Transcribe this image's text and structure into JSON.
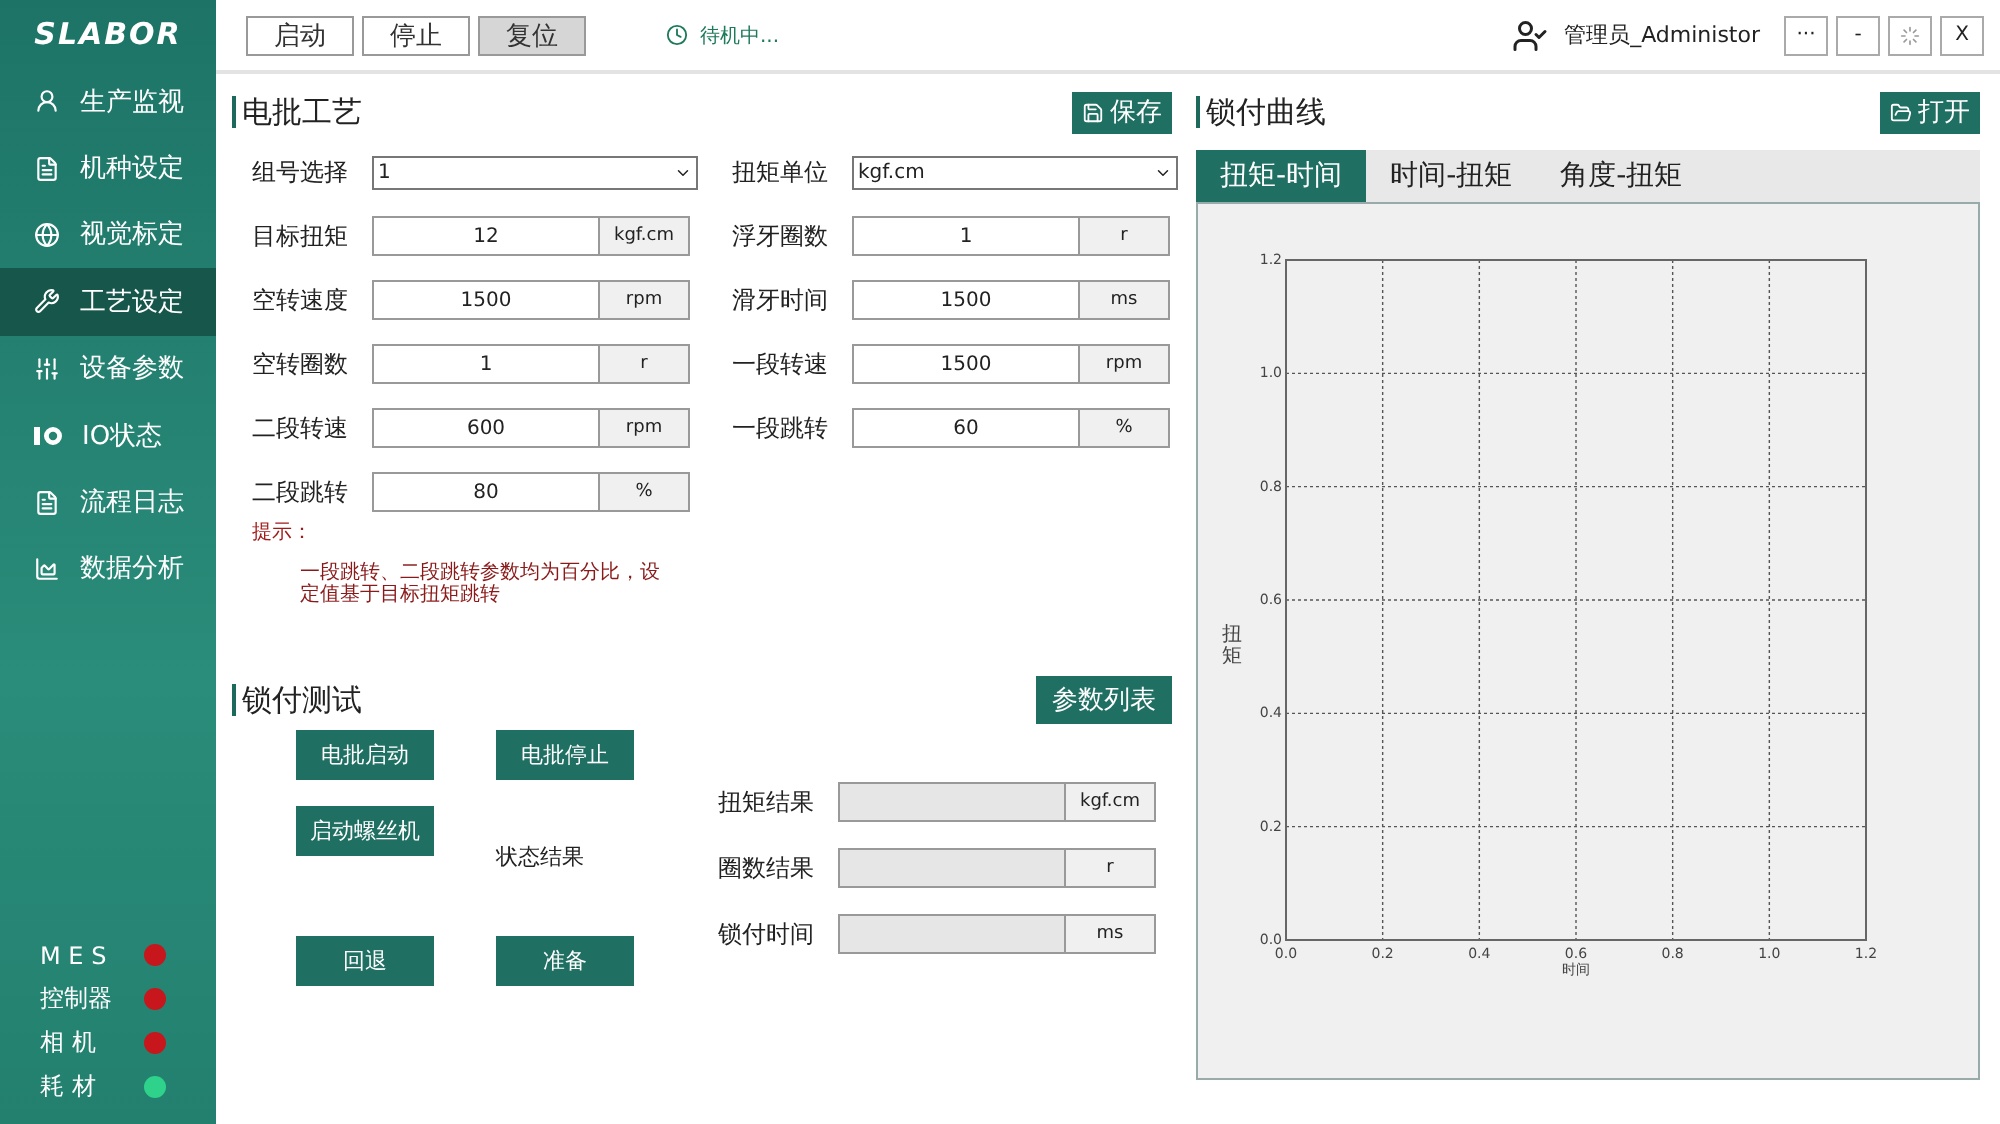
{
  "logo": "SLABOR",
  "sidebar": {
    "items": [
      {
        "label": "生产监视",
        "selected": false
      },
      {
        "label": "机种设定",
        "selected": false
      },
      {
        "label": "视觉标定",
        "selected": false
      },
      {
        "label": "工艺设定",
        "selected": true
      },
      {
        "label": "设备参数",
        "selected": false
      },
      {
        "label": "IO状态",
        "selected": false
      },
      {
        "label": "流程日志",
        "selected": false
      },
      {
        "label": "数据分析",
        "selected": false
      }
    ],
    "status": [
      {
        "label": "M E S",
        "color": "#c8161d"
      },
      {
        "label": "控制器",
        "color": "#c8161d"
      },
      {
        "label": "相 机",
        "color": "#c8161d"
      },
      {
        "label": "耗 材",
        "color": "#2ed28a"
      }
    ]
  },
  "toolbar": {
    "buttons": [
      {
        "label": "启动",
        "selected": false
      },
      {
        "label": "停止",
        "selected": false
      },
      {
        "label": "复位",
        "selected": true
      }
    ],
    "status": "待机中...",
    "user": "管理员_Administor",
    "window_buttons": [
      "···",
      "-",
      "X"
    ]
  },
  "process": {
    "title": "电批工艺",
    "save": "保存",
    "rows": [
      [
        {
          "label": "组号选择",
          "kind": "select",
          "value": "1"
        },
        {
          "label": "扭矩单位",
          "kind": "select",
          "value": "kgf.cm"
        }
      ],
      [
        {
          "label": "目标扭矩",
          "kind": "input",
          "value": "12",
          "unit": "kgf.cm"
        },
        {
          "label": "浮牙圈数",
          "kind": "input",
          "value": "1",
          "unit": "r"
        }
      ],
      [
        {
          "label": "空转速度",
          "kind": "input",
          "value": "1500",
          "unit": "rpm"
        },
        {
          "label": "滑牙时间",
          "kind": "input",
          "value": "1500",
          "unit": "ms"
        }
      ],
      [
        {
          "label": "空转圈数",
          "kind": "input",
          "value": "1",
          "unit": "r"
        },
        {
          "label": "一段转速",
          "kind": "input",
          "value": "1500",
          "unit": "rpm"
        }
      ],
      [
        {
          "label": "二段转速",
          "kind": "input",
          "value": "600",
          "unit": "rpm"
        },
        {
          "label": "一段跳转",
          "kind": "input",
          "value": "60",
          "unit": "%"
        }
      ],
      [
        {
          "label": "二段跳转",
          "kind": "input",
          "value": "80",
          "unit": "%"
        }
      ]
    ],
    "hint_title": "提示：",
    "hint": "一段跳转、二段跳转参数均为百分比，设定值基于目标扭矩跳转"
  },
  "test": {
    "title": "锁付测试",
    "param_list": "参数列表",
    "buttons": [
      "电批启动",
      "电批停止",
      "启动螺丝机",
      "回退",
      "准备"
    ],
    "state_label": "状态结果",
    "results": [
      {
        "label": "扭矩结果",
        "unit": "kgf.cm"
      },
      {
        "label": "圈数结果",
        "unit": "r"
      },
      {
        "label": "锁付时间",
        "unit": "ms"
      }
    ]
  },
  "curve": {
    "title": "锁付曲线",
    "open": "打开",
    "tabs": [
      {
        "label": "扭矩-时间",
        "selected": true
      },
      {
        "label": "时间-扭矩",
        "selected": false
      },
      {
        "label": "角度-扭矩",
        "selected": false
      }
    ],
    "chart_data": {
      "type": "line",
      "grid": true,
      "xlabel": "时间",
      "ylabel": "扭矩",
      "xlim": [
        0,
        1.2
      ],
      "ylim": [
        0,
        1.2
      ],
      "xticks": [
        {
          "value": 0,
          "label": "0.0"
        },
        {
          "value": 0.2,
          "label": "0.2"
        },
        {
          "value": 0.4,
          "label": "0.4"
        },
        {
          "value": 0.6,
          "label": "0.6"
        },
        {
          "value": 0.8,
          "label": "0.8"
        },
        {
          "value": 1,
          "label": "1.0"
        },
        {
          "value": 1.2,
          "label": "1.2"
        }
      ],
      "yticks": [
        {
          "value": 0,
          "label": "0.0"
        },
        {
          "value": 0.2,
          "label": "0.2"
        },
        {
          "value": 0.4,
          "label": "0.4"
        },
        {
          "value": 0.6,
          "label": "0.6"
        },
        {
          "value": 0.8,
          "label": "0.8"
        },
        {
          "value": 1,
          "label": "1.0"
        },
        {
          "value": 1.2,
          "label": "1.2"
        }
      ]
    }
  }
}
